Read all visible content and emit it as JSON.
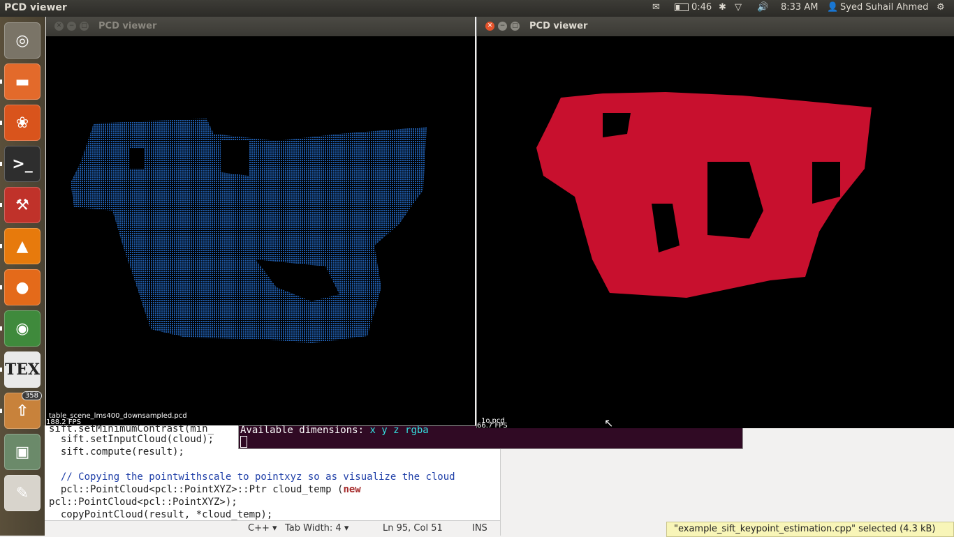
{
  "topbar": {
    "app_title": "PCD viewer",
    "battery_time": "0:46",
    "clock": "8:33 AM",
    "user": "Syed Suhail Ahmed"
  },
  "launcher": {
    "items": [
      {
        "name": "dash-home",
        "icon": "ubuntu-icon",
        "color": "#7a7467"
      },
      {
        "name": "files",
        "icon": "folder-icon",
        "color": "#e36a2b"
      },
      {
        "name": "software-center",
        "icon": "shopping-bag-icon",
        "color": "#d9541c"
      },
      {
        "name": "terminal",
        "icon": "terminal-icon",
        "color": "#2e2e2e"
      },
      {
        "name": "system-settings",
        "icon": "settings-icon",
        "color": "#c0322a"
      },
      {
        "name": "vlc",
        "icon": "vlc-cone-icon",
        "color": "#e77a0c"
      },
      {
        "name": "firefox",
        "icon": "firefox-icon",
        "color": "#e46a1a"
      },
      {
        "name": "chrome",
        "icon": "chrome-icon",
        "color": "#3f8a3c"
      },
      {
        "name": "tex",
        "icon": "tex-icon",
        "color": "#e9e9e9"
      },
      {
        "name": "updates",
        "icon": "update-box-icon",
        "color": "#c8823b"
      },
      {
        "name": "disks",
        "icon": "disk-icon",
        "color": "#6b8a6a"
      },
      {
        "name": "text-editor",
        "icon": "text-editor-icon",
        "color": "#d8d4cc"
      }
    ],
    "updates_badge": "358",
    "tex_glyph": "TEX"
  },
  "window_left": {
    "title": "PCD viewer",
    "cloud_color": "#1e5aa8",
    "file_label": "table_scene_lms400_downsampled.pcd",
    "fps": "188.2 FPS"
  },
  "window_right": {
    "title": "PCD viewer",
    "cloud_color": "#c8102e",
    "file_label": "1o.pcd",
    "fps": "66.7 FPS"
  },
  "terminal": {
    "prefix": "Available dimensions:",
    "dims": "x y z rgba"
  },
  "editor": {
    "lines": [
      "sift.setMinimumContrast(min_",
      "  sift.setInputCloud(cloud);",
      "  sift.compute(result);",
      "",
      "  // Copying the pointwithscale to pointxyz so as visualize the cloud",
      "  pcl::PointCloud<pcl::PointXYZ>::Ptr cloud_temp (",
      "pcl::PointCloud<pcl::PointXYZ>);",
      "  copyPointCloud(result, *cloud_temp);"
    ],
    "keyword_new": "new",
    "status": {
      "language": "C++",
      "tab_width": "Tab Width:  4",
      "position": "Ln 95, Col 51",
      "mode": "INS"
    }
  },
  "tooltip": "\"example_sift_keypoint_estimation.cpp\" selected  (4.3 kB)"
}
